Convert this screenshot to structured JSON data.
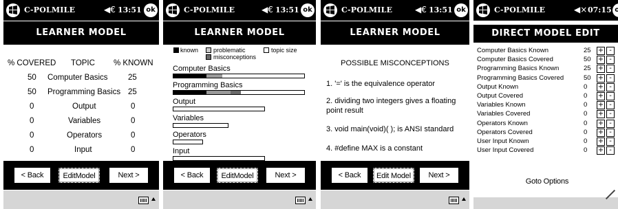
{
  "app": {
    "title": "C-POLMILE",
    "ok_label": "ok",
    "speaker": "◀€"
  },
  "screens": [
    {
      "time": "13:51",
      "header": "LEARNER MODEL",
      "table": {
        "columns": [
          "% COVERED",
          "TOPIC",
          "% KNOWN"
        ],
        "rows": [
          [
            "50",
            "Computer Basics",
            "25"
          ],
          [
            "50",
            "Programming Basics",
            "25"
          ],
          [
            "0",
            "Output",
            "0"
          ],
          [
            "0",
            "Variables",
            "0"
          ],
          [
            "0",
            "Operators",
            "0"
          ],
          [
            "0",
            "Input",
            "0"
          ]
        ]
      },
      "buttons": {
        "back": "< Back",
        "edit": "EditModel",
        "next": "Next >"
      }
    },
    {
      "time": "13:51",
      "header": "LEARNER MODEL",
      "legend": {
        "known": "known",
        "problematic": "problematic",
        "topic_size": "topic size",
        "misconceptions": "misconceptions"
      },
      "topics": [
        {
          "name": "Computer Basics",
          "topic_size": 1.0,
          "known": 0.25,
          "problematic": 0.12
        },
        {
          "name": "Programming Basics",
          "topic_size": 1.0,
          "known": 0.25,
          "problematic": 0.18,
          "misconceptions": 0.08
        },
        {
          "name": "Output",
          "topic_size": 0.7
        },
        {
          "name": "Variables",
          "topic_size": 0.42
        },
        {
          "name": "Operators",
          "topic_size": 0.23
        },
        {
          "name": "Input",
          "topic_size": 0.7
        }
      ],
      "colors": {
        "known": "#000000",
        "problematic": "#9a9a9a",
        "misconceptions": "#6a6a6a",
        "topic_size": "#ffffff"
      },
      "buttons": {
        "back": "< Back",
        "edit": "EditModel",
        "next": "Next >"
      }
    },
    {
      "time": "13:51",
      "header": "LEARNER MODEL",
      "title": "POSSIBLE MISCONCEPTIONS",
      "items": [
        "1. '=' is the equivalence operator",
        "2. dividing two integers gives a floating point result",
        "3. void main(void)( ); is ANSI standard",
        "4. #define MAX is a constant"
      ],
      "buttons": {
        "back": "< Back",
        "edit": "Edit Model",
        "next": "Next >"
      }
    },
    {
      "time": "07:15",
      "speaker": "◀×",
      "header": "DIRECT MODEL EDIT",
      "rows": [
        {
          "label": "Computer Basics Known",
          "value": "25"
        },
        {
          "label": "Computer Basics Covered",
          "value": "50"
        },
        {
          "label": "Programming Basics Known",
          "value": "25"
        },
        {
          "label": "Programming Basics Covered",
          "value": "50"
        },
        {
          "label": "Output Known",
          "value": "0"
        },
        {
          "label": "Output Covered",
          "value": "0"
        },
        {
          "label": "Variables Known",
          "value": "0"
        },
        {
          "label": "Variables Covered",
          "value": "0"
        },
        {
          "label": "Operators Known",
          "value": "0"
        },
        {
          "label": "Operators Covered",
          "value": "0"
        },
        {
          "label": "User Input Known",
          "value": "0"
        },
        {
          "label": "User Input Covered",
          "value": "0"
        }
      ],
      "plus": "+",
      "minus": "-",
      "goto": "Goto Options"
    }
  ]
}
